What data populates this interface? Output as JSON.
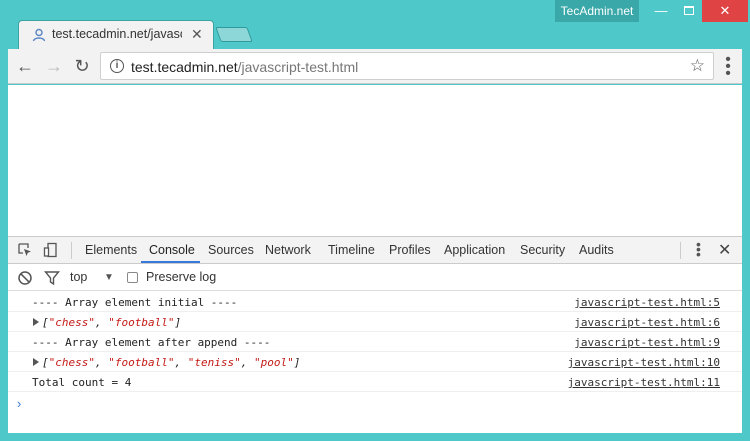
{
  "window": {
    "label": "TecAdmin.net",
    "min_glyph": "—",
    "close_glyph": "✕"
  },
  "tab": {
    "title": "test.tecadmin.net/javascript-test.html",
    "close_glyph": "✕"
  },
  "toolbar": {
    "back_glyph": "←",
    "forward_glyph": "→",
    "reload_glyph": "↻",
    "url_host": "test.tecadmin.net",
    "url_path": "/javascript-test.html",
    "info_glyph": "i",
    "star_glyph": "☆"
  },
  "devtools": {
    "tabs": [
      "Elements",
      "Console",
      "Sources",
      "Network",
      "Timeline",
      "Profiles",
      "Application",
      "Security",
      "Audits"
    ],
    "active_tab": "Console",
    "close_glyph": "✕",
    "context": "top",
    "preserve_log_label": "Preserve log",
    "preserve_log_checked": false,
    "prompt_glyph": "›"
  },
  "console_rows": [
    {
      "type": "text",
      "message": "---- Array element initial ----",
      "source": "javascript-test.html:5"
    },
    {
      "type": "array",
      "items": [
        "chess",
        "football"
      ],
      "source": "javascript-test.html:6"
    },
    {
      "type": "text",
      "message": "---- Array element after append ----",
      "source": "javascript-test.html:9"
    },
    {
      "type": "array",
      "items": [
        "chess",
        "football",
        "teniss",
        "pool"
      ],
      "source": "javascript-test.html:10"
    },
    {
      "type": "text",
      "message": "Total count = 4",
      "source": "javascript-test.html:11"
    }
  ],
  "colors": {
    "frame": "#4ec8c9",
    "accent": "#3879d9",
    "string": "#c41a16",
    "close_button": "#e04343"
  }
}
